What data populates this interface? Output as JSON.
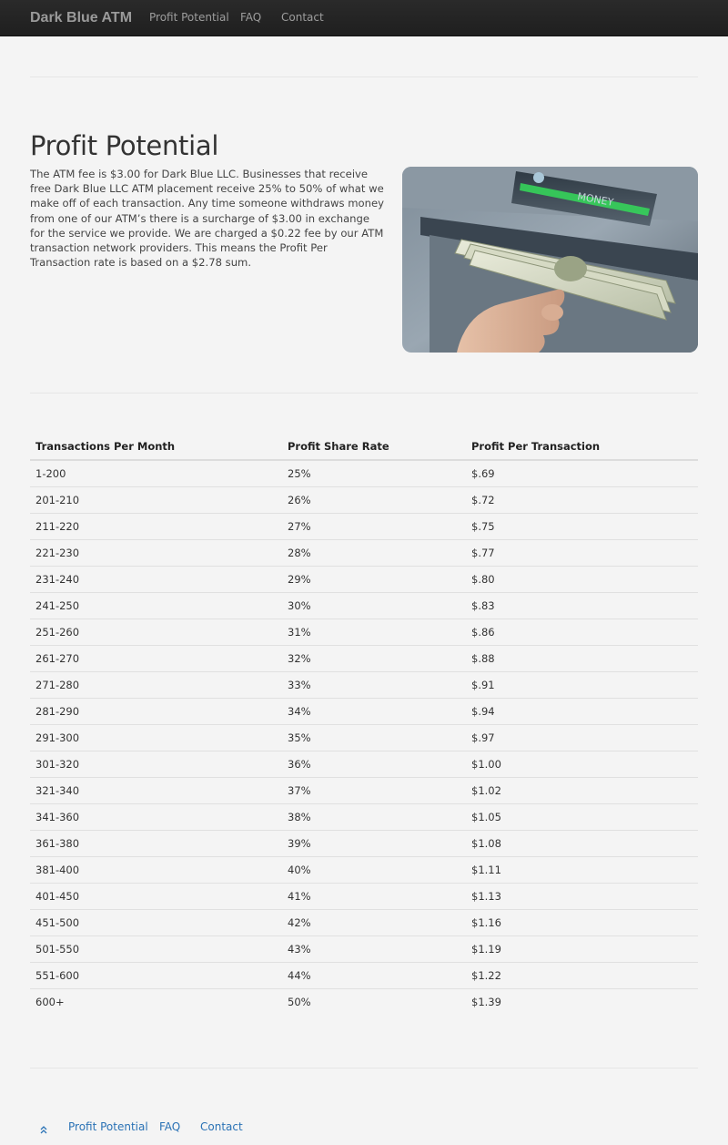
{
  "navbar": {
    "brand": "Dark Blue ATM",
    "links": [
      "Profit Potential",
      "FAQ",
      "Contact"
    ]
  },
  "main": {
    "title": "Profit Potential",
    "intro": "The ATM fee is $3.00 for Dark Blue LLC. Businesses that receive free Dark Blue LLC ATM placement receive 25% to 50% of what we make off of each transaction. Any time someone withdraws money from one of our ATM’s there is a surcharge of $3.00 in exchange for the service we provide. We are charged a $0.22 fee by our ATM transaction network providers. This means the Profit Per Transaction rate is based on a $2.78 sum.",
    "image": {
      "icon": "atm-cash-photo",
      "screen_label": "MONEY"
    }
  },
  "table": {
    "headers": [
      "Transactions Per Month",
      "Profit Share Rate",
      "Profit Per Transaction"
    ],
    "rows": [
      [
        "1-200",
        "25%",
        "$.69"
      ],
      [
        "201-210",
        "26%",
        "$.72"
      ],
      [
        "211-220",
        "27%",
        "$.75"
      ],
      [
        "221-230",
        "28%",
        "$.77"
      ],
      [
        "231-240",
        "29%",
        "$.80"
      ],
      [
        "241-250",
        "30%",
        "$.83"
      ],
      [
        "251-260",
        "31%",
        "$.86"
      ],
      [
        "261-270",
        "32%",
        "$.88"
      ],
      [
        "271-280",
        "33%",
        "$.91"
      ],
      [
        "281-290",
        "34%",
        "$.94"
      ],
      [
        "291-300",
        "35%",
        "$.97"
      ],
      [
        "301-320",
        "36%",
        "$1.00"
      ],
      [
        "321-340",
        "37%",
        "$1.02"
      ],
      [
        "341-360",
        "38%",
        "$1.05"
      ],
      [
        "361-380",
        "39%",
        "$1.08"
      ],
      [
        "381-400",
        "40%",
        "$1.11"
      ],
      [
        "401-450",
        "41%",
        "$1.13"
      ],
      [
        "451-500",
        "42%",
        "$1.16"
      ],
      [
        "501-550",
        "43%",
        "$1.19"
      ],
      [
        "551-600",
        "44%",
        "$1.22"
      ],
      [
        "600+",
        "50%",
        "$1.39"
      ]
    ]
  },
  "footer": {
    "links": [
      "Profit Potential",
      "FAQ",
      "Contact"
    ],
    "top_icon": "double-chevron-up-icon"
  },
  "colors": {
    "navbar_bg": "#222222",
    "link": "#2a72b5",
    "page_bg": "#f4f4f4"
  }
}
